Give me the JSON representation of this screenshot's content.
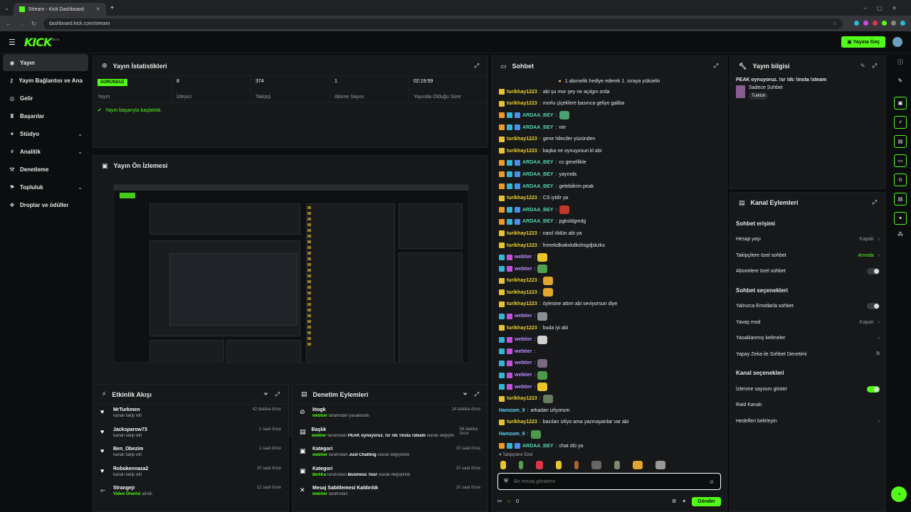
{
  "browser": {
    "tab_title": "Stream - Kick Dashboard",
    "url": "dashboard.kick.com/stream"
  },
  "topbar": {
    "logo": "KICK",
    "beta": "BETA",
    "go_live": "Yayına Geç"
  },
  "sidebar": {
    "items": [
      {
        "label": "Yayın",
        "icon": "broadcast-icon",
        "active": true
      },
      {
        "label": "Yayın Bağlantısı ve Anahtarı",
        "icon": "key-icon"
      },
      {
        "label": "Gelir",
        "icon": "money-icon"
      },
      {
        "label": "Başarılar",
        "icon": "trophy-icon"
      },
      {
        "label": "Stüdyo",
        "icon": "studio-icon",
        "chevron": true
      },
      {
        "label": "Analitik",
        "icon": "chart-icon",
        "chevron": true
      },
      {
        "label": "Denetleme",
        "icon": "hammer-icon"
      },
      {
        "label": "Topluluk",
        "icon": "community-icon",
        "chevron": true
      },
      {
        "label": "Droplar ve ödüller",
        "icon": "gift-icon"
      }
    ]
  },
  "stats": {
    "title": "Yayın İstatistikleri",
    "status_badge": "SORUNSUZ",
    "status_label": "Yayın",
    "viewers": "8",
    "viewers_label": "İzleyici",
    "followers": "374",
    "followers_label": "Takipçi",
    "subs": "1",
    "subs_label": "Abone Sayısı",
    "uptime": "02:19:59",
    "uptime_label": "Yayında Olduğu Süre",
    "success_msg": "Yayın başarıyla başlatıldı."
  },
  "preview": {
    "title": "Yayın Ön İzlemesi"
  },
  "activity": {
    "title": "Etkinlik Akışı",
    "items": [
      {
        "name": "MrTurkmen",
        "sub": "kanalı takip etti",
        "time": "42 dakika önce",
        "icon": "heart-icon",
        "sym": "♥"
      },
      {
        "name": "Jacksparow73",
        "sub": "kanalı takip etti",
        "time": "1 saat önce",
        "icon": "heart-icon",
        "sym": "♥"
      },
      {
        "name": "Ben_Obezim",
        "sub": "kanalı takip etti",
        "time": "1 saat önce",
        "icon": "heart-icon",
        "sym": "♥"
      },
      {
        "name": "Robokennaza2",
        "sub": "kanalı takip etti",
        "time": "10 saat önce",
        "icon": "heart-icon",
        "sym": "♥"
      },
      {
        "name": "Strangejr",
        "sub_hl": "Video Önerisi",
        "sub": "alındı",
        "time": "12 saat önce",
        "icon": "share-icon",
        "sym": "⟜"
      }
    ]
  },
  "moderation": {
    "title": "Denetim Eylemleri",
    "items": [
      {
        "title": "ktogk",
        "who": "webtier",
        "rest": "tarafından yasaklandı",
        "extra": "",
        "tail": "",
        "time": "14 dakika önce",
        "sym": "⊘"
      },
      {
        "title": "Başlık",
        "who": "webtier",
        "rest": "tarafından",
        "extra": "PEAK oynuyoruz. !sr !dc !insta !steam",
        "tail": "olarak değiştirildi",
        "time": "58 dakika önce",
        "sym": "▤"
      },
      {
        "title": "Kategori",
        "who": "webtier",
        "rest": "tarafından",
        "extra": "Just Chatting",
        "tail": "olarak değiştirildi",
        "time": "10 saat önce",
        "sym": "▣"
      },
      {
        "title": "Kategori",
        "who": "BeXKa",
        "rest": "tarafından",
        "extra": "Business Tour",
        "tail": "olarak değiştirildi",
        "time": "10 saat önce",
        "sym": "▣"
      },
      {
        "title": "Mesaj Sabitlemesi Kaldırıldı",
        "who": "webtier",
        "rest": "tarafından",
        "extra": "",
        "tail": "",
        "time": "10 saat önce",
        "sym": "✕"
      }
    ]
  },
  "chat": {
    "title": "Sohbet",
    "banner": "1 abonelik hediye ederek 1. sıraya yükselin",
    "followers_only": "Takipçilere Özel",
    "input_placeholder": "Bir mesaj gönderin",
    "send": "Gönder",
    "points": "0",
    "lines": [
      {
        "user": "turikhay1223",
        "cls": "u-y",
        "badges": [
          "b-y"
        ],
        "msg": "abi şu mor şey ne açılgın orda"
      },
      {
        "user": "turikhay1223",
        "cls": "u-y",
        "badges": [
          "b-y"
        ],
        "msg": "morlu çiçeklere basınca geliyo galiba"
      },
      {
        "user": "ARDAA_BEY",
        "cls": "u-g",
        "badges": [
          "b-o",
          "b-c",
          "b-bl"
        ],
        "msg": "",
        "emote": "#4aa070"
      },
      {
        "user": "ARDAA_BEY",
        "cls": "u-g",
        "badges": [
          "b-o",
          "b-c",
          "b-bl"
        ],
        "msg": "nie"
      },
      {
        "user": "turikhay1223",
        "cls": "u-y",
        "badges": [
          "b-y"
        ],
        "msg": "gene hileciler yüzünden"
      },
      {
        "user": "turikhay1223",
        "cls": "u-y",
        "badges": [
          "b-y"
        ],
        "msg": "başka ne oynuyosun kl abi"
      },
      {
        "user": "ARDAA_BEY",
        "cls": "u-g",
        "badges": [
          "b-o",
          "b-c",
          "b-bl"
        ],
        "msg": "cs genellikle"
      },
      {
        "user": "ARDAA_BEY",
        "cls": "u-g",
        "badges": [
          "b-o",
          "b-c",
          "b-bl"
        ],
        "msg": "yayında"
      },
      {
        "user": "ARDAA_BEY",
        "cls": "u-g",
        "badges": [
          "b-o",
          "b-c",
          "b-bl"
        ],
        "msg": "gelebilirim peak"
      },
      {
        "user": "turikhay1223",
        "cls": "u-y",
        "badges": [
          "b-y"
        ],
        "msg": "CS iyidir ya"
      },
      {
        "user": "ARDAA_BEY",
        "cls": "u-g",
        "badges": [
          "b-o",
          "b-c",
          "b-bl"
        ],
        "msg": "",
        "emote": "#c0392b"
      },
      {
        "user": "ARDAA_BEY",
        "cls": "u-g",
        "badges": [
          "b-o",
          "b-c",
          "b-bl"
        ],
        "msg": "pgksldgmdg"
      },
      {
        "user": "turikhay1223",
        "cls": "u-y",
        "badges": [
          "b-y"
        ],
        "msg": "nasıl öldün abi ya"
      },
      {
        "user": "turikhay1223",
        "cls": "u-y",
        "badges": [
          "b-y"
        ],
        "msg": "fnmekdkwkxkdkshsgdjskzks"
      },
      {
        "user": "webtier",
        "cls": "u-v",
        "badges": [
          "b-c",
          "b-p"
        ],
        "msg": "",
        "emote": "#e8c62a"
      },
      {
        "user": "webtier",
        "cls": "u-v",
        "badges": [
          "b-c",
          "b-p"
        ],
        "msg": "",
        "emote": "#53a050"
      },
      {
        "user": "turikhay1223",
        "cls": "u-y",
        "badges": [
          "b-y"
        ],
        "msg": "",
        "emote": "#e0a630"
      },
      {
        "user": "turikhay1223",
        "cls": "u-y",
        "badges": [
          "b-y"
        ],
        "msg": "",
        "emote": "#e0a630"
      },
      {
        "user": "turikhay1223",
        "cls": "u-y",
        "badges": [
          "b-y"
        ],
        "msg": "öylesine attım abi seviyorsun diye"
      },
      {
        "user": "webtier",
        "cls": "u-v",
        "badges": [
          "b-c",
          "b-p"
        ],
        "msg": "",
        "emote": "#8a8f95"
      },
      {
        "user": "turikhay1223",
        "cls": "u-y",
        "badges": [
          "b-y"
        ],
        "msg": "buda iyi abi"
      },
      {
        "user": "webtier",
        "cls": "u-v",
        "badges": [
          "b-c",
          "b-p"
        ],
        "msg": "",
        "emote": "#cfcfcf"
      },
      {
        "user": "webtier",
        "cls": "u-v",
        "badges": [
          "b-c",
          "b-p"
        ],
        "msg": ""
      },
      {
        "user": "webtier",
        "cls": "u-v",
        "badges": [
          "b-c",
          "b-p"
        ],
        "msg": "",
        "emote": "#7a6a80"
      },
      {
        "user": "webtier",
        "cls": "u-v",
        "badges": [
          "b-c",
          "b-p"
        ],
        "msg": "",
        "emote": "#4c9a4a"
      },
      {
        "user": "webtier",
        "cls": "u-v",
        "badges": [
          "b-c",
          "b-p"
        ],
        "msg": "",
        "emote": "#e8c62a"
      },
      {
        "user": "turikhay1223",
        "cls": "u-y",
        "badges": [
          "b-y"
        ],
        "msg": "",
        "emote": "#6a7c60"
      },
      {
        "user": "Hamzam_9",
        "cls": "u-c",
        "badges": [],
        "msg": "arkadan izliyorum"
      },
      {
        "user": "turikhay1223",
        "cls": "u-y",
        "badges": [
          "b-y"
        ],
        "msg": "bazıları izliyo ama yazmayanlar var abi"
      },
      {
        "user": "Hamzam_9",
        "cls": "u-c",
        "badges": [],
        "msg": "",
        "emote": "#4c9a4a"
      },
      {
        "user": "ARDAA_BEY",
        "cls": "u-g",
        "badges": [
          "b-o",
          "b-c",
          "b-bl"
        ],
        "msg": "chat ölü ya"
      }
    ]
  },
  "stream_info": {
    "title": "Yayın bilgisi",
    "stream_title": "PEAK oynuyoruz. !sr !dc !insta !steam",
    "category": "Sadece Sohbet",
    "language": "Turkish"
  },
  "channel_actions": {
    "title": "Kanal Eylemleri",
    "chat_access": "Sohbet erişimi",
    "account_age": "Hesap yaşı",
    "account_age_val": "Kapalı",
    "follower_chat": "Takipçilere özel sohbet",
    "follower_chat_val": "Anında",
    "sub_chat": "Abonelere özel sohbet",
    "chat_options": "Sohbet seçenekleri",
    "emote_only": "Yalnızca Emotlarla sohbet",
    "slow_mode": "Yavaş mod",
    "slow_mode_val": "Kapalı",
    "banned_words": "Yasaklanmış kelimeler",
    "ai_mod": "Yapay Zeka ile Sohbet Denetimi",
    "channel_options": "Kanal seçenekleri",
    "show_viewers": "İzlenme sayısını göster",
    "raid": "Raid Kanalı",
    "goals": "Hedefleri belirleyin"
  },
  "colors": {
    "accent": "#53fc18",
    "bg": "#0b0d0e",
    "panel": "#16181a"
  }
}
